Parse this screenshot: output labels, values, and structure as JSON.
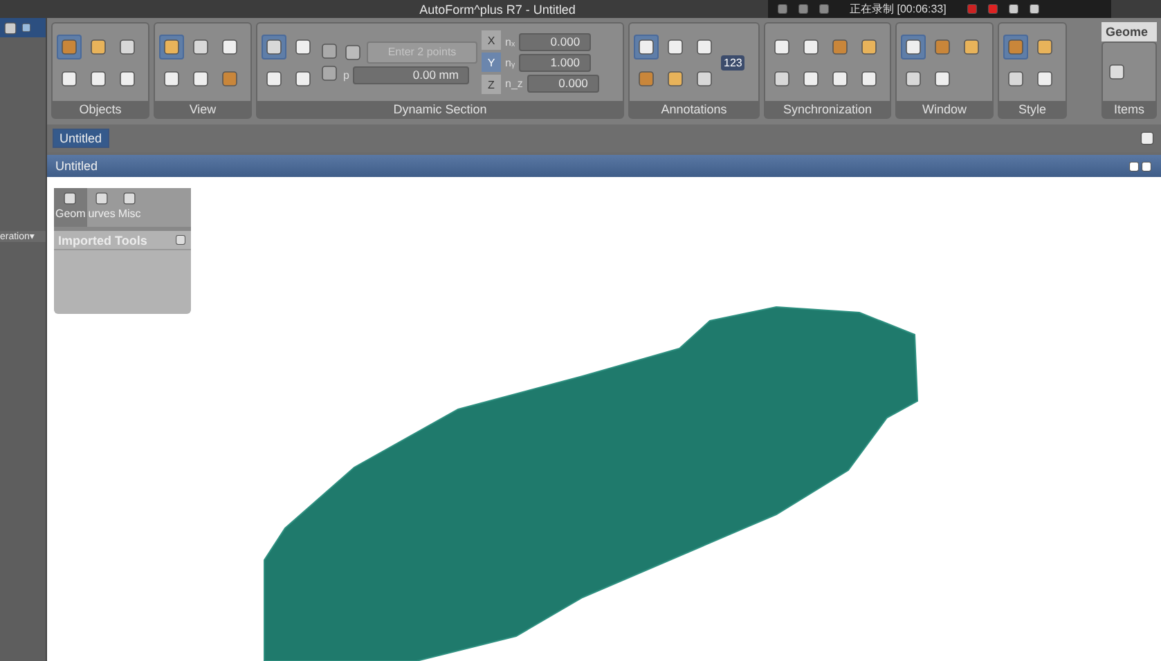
{
  "window": {
    "title": "AutoForm^plus R7 - Untitled"
  },
  "recorder": {
    "status": "正在录制 [00:06:33]"
  },
  "left_strip": {
    "dropdown": "eration▾"
  },
  "ribbon": {
    "groups": [
      {
        "kind": "icons",
        "label": "Objects",
        "tools": [
          {
            "selected": true
          },
          {
            "selected": false
          },
          {
            "selected": false
          },
          {
            "selected": false
          },
          {
            "selected": false
          },
          {
            "selected": false
          }
        ]
      },
      {
        "kind": "icons",
        "label": "View",
        "tools": [
          {
            "selected": true
          },
          {
            "selected": false
          },
          {
            "selected": false
          },
          {
            "selected": false
          },
          {
            "selected": false
          },
          {
            "selected": false
          }
        ]
      },
      {
        "kind": "section",
        "label": "Dynamic Section",
        "tools": [
          {
            "selected": true
          },
          {
            "selected": false
          },
          {
            "selected": false
          },
          {
            "selected": false
          }
        ],
        "points": {
          "placeholder": "Enter 2 points"
        },
        "p_label": "p",
        "p_value": "0.00 mm",
        "axes": [
          {
            "label": "X",
            "selected": false
          },
          {
            "label": "Y",
            "selected": true
          },
          {
            "label": "Z",
            "selected": false
          }
        ],
        "normals": [
          {
            "label": "nₓ",
            "value": "0.000"
          },
          {
            "label": "nᵧ",
            "value": "1.000"
          },
          {
            "label": "n_z",
            "value": "0.000"
          }
        ]
      },
      {
        "kind": "annotations",
        "label": "Annotations",
        "counter": "123",
        "tools": [
          {
            "selected": true
          },
          {
            "selected": false
          },
          {
            "selected": false
          },
          {
            "selected": false
          },
          {
            "selected": false
          },
          {
            "selected": false
          }
        ]
      },
      {
        "kind": "icons",
        "label": "Synchronization",
        "tools": [
          {
            "selected": false
          },
          {
            "selected": false
          },
          {
            "selected": false
          },
          {
            "selected": false
          },
          {
            "selected": false
          },
          {
            "selected": false
          },
          {
            "selected": false
          },
          {
            "selected": false
          }
        ]
      },
      {
        "kind": "icons",
        "label": "Window",
        "tools": [
          {
            "selected": true
          },
          {
            "selected": false
          },
          {
            "selected": false
          },
          {
            "selected": false
          },
          {
            "selected": false
          }
        ]
      },
      {
        "kind": "icons",
        "label": "Style",
        "tools": [
          {
            "selected": true
          },
          {
            "selected": false
          },
          {
            "selected": false
          },
          {
            "selected": false
          }
        ]
      }
    ],
    "side_tab": "Geome",
    "side_group": "Items"
  },
  "document_tab": {
    "label": "Untitled",
    "selected": true
  },
  "view": {
    "title": "Untitled"
  },
  "tool_panel": {
    "tabs": [
      {
        "label": "Geom",
        "selected": true
      },
      {
        "label": "urves",
        "selected": false
      },
      {
        "label": "Misc",
        "selected": false
      }
    ],
    "items": [
      {
        "label": "Imported Tools"
      }
    ]
  }
}
